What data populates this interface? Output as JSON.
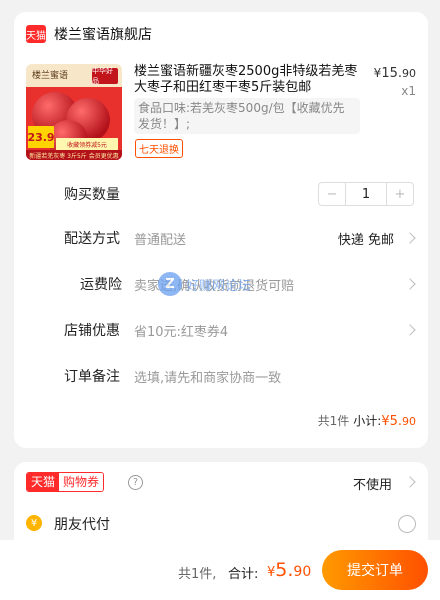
{
  "shop": {
    "badge": "天猫",
    "name": "楼兰蜜语旗舰店"
  },
  "product": {
    "image": {
      "brand": "楼兰蜜语",
      "chip": "中华好品",
      "price": "23.9",
      "promo": "收藏领券减5元",
      "footer": "新疆若羌灰枣 3斤5斤 会员更优惠"
    },
    "title": "楼兰蜜语新疆灰枣2500g非特级若羌枣大枣子和田红枣干枣5斤装包邮",
    "spec": "食品口味:若羌灰枣500g/包【收藏优先发货！】;",
    "tag": "七天退换",
    "price_symbol": "¥",
    "price_int": "15.",
    "price_dec": "90",
    "quantity_text": "x1"
  },
  "rows": {
    "quantity": {
      "label": "购买数量",
      "minus": "−",
      "value": "1",
      "plus": "+"
    },
    "delivery": {
      "label": "配送方式",
      "value": "普通配送",
      "right": "快递 免邮"
    },
    "insurance": {
      "label": "运费险",
      "value": "卖家送,确认收货前退货可赔"
    },
    "discount": {
      "label": "店铺优惠",
      "value": "省10元:红枣券4"
    },
    "remark": {
      "label": "订单备注",
      "placeholder": "选填,请先和商家协商一致"
    }
  },
  "watermark": {
    "icon": "Z",
    "text": "好赚网论坛"
  },
  "subtotal": {
    "count": "共1件",
    "label": "小计:",
    "symbol": "¥",
    "int": "5.",
    "dec": "90"
  },
  "coupon": {
    "badge_a": "天猫",
    "badge_b": "购物券",
    "help": "?",
    "right": "不使用"
  },
  "friend_pay": {
    "icon": "¥",
    "label": "朋友代付"
  },
  "footer": {
    "count": "共1件,",
    "total_label": "合计:",
    "symbol": "¥",
    "int": "5.",
    "dec": "90",
    "submit": "提交订单"
  },
  "colors": {
    "accent": "#ff5000",
    "tmall_red": "#ff2a2a",
    "page_bg": "#f2f2f2"
  }
}
